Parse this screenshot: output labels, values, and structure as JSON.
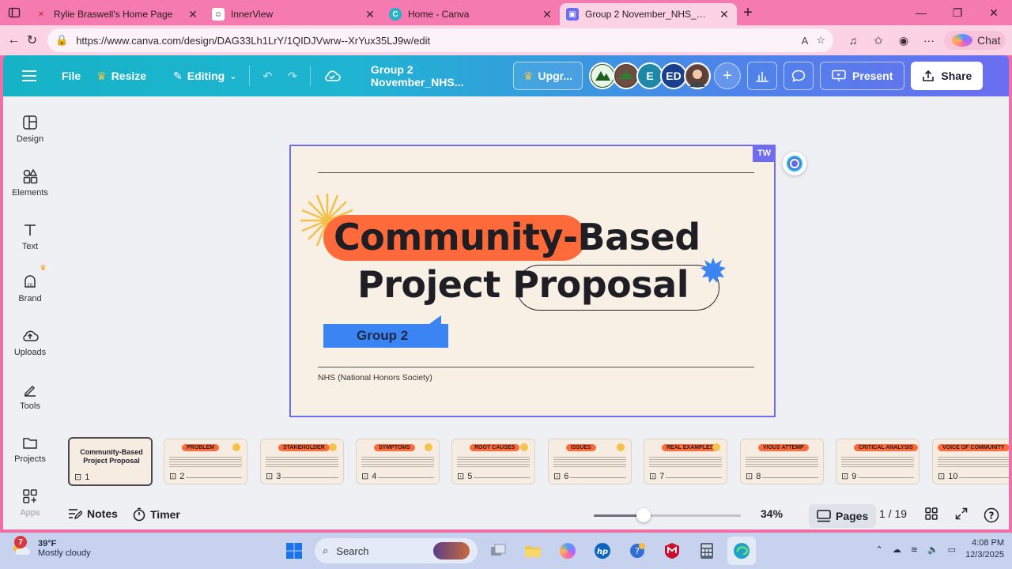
{
  "browser": {
    "tabs": [
      {
        "title": "Rylie Braswell's Home Page",
        "active": false
      },
      {
        "title": "InnerView",
        "active": false
      },
      {
        "title": "Home - Canva",
        "active": false
      },
      {
        "title": "Group 2 November_NHS_Commu",
        "active": true
      }
    ],
    "url": "https://www.canva.com/design/DAG33Lh1LrY/1QIDJVwrw--XrYux35LJ9w/edit",
    "chat_label": "Chat"
  },
  "canva_header": {
    "file_label": "File",
    "resize_label": "Resize",
    "editing_label": "Editing",
    "doc_title": "Group 2 November_NHS...",
    "upgrade_label": "Upgr...",
    "avatars": [
      "",
      "",
      "E",
      "ED",
      ""
    ],
    "present_label": "Present",
    "share_label": "Share"
  },
  "sidebar": {
    "items": [
      {
        "label": "Design",
        "icon": "design-icon"
      },
      {
        "label": "Elements",
        "icon": "elements-icon"
      },
      {
        "label": "Text",
        "icon": "text-icon"
      },
      {
        "label": "Brand",
        "icon": "brand-icon"
      },
      {
        "label": "Uploads",
        "icon": "uploads-icon"
      },
      {
        "label": "Tools",
        "icon": "tools-icon"
      },
      {
        "label": "Projects",
        "icon": "projects-icon"
      },
      {
        "label": "Apps",
        "icon": "apps-icon"
      }
    ]
  },
  "slide": {
    "badge": "TW",
    "title_line1_a": "Community",
    "title_line1_b": "-Based",
    "title_line2_a": "Project",
    "title_line2_b": "Proposal",
    "group_label": "Group 2",
    "footer": "NHS (National Honors Society)"
  },
  "thumbnails": [
    {
      "num": "1",
      "title": "Community-Based Project Proposal"
    },
    {
      "num": "2",
      "title": "PROBLEM"
    },
    {
      "num": "3",
      "title": "STAKEHOLDER"
    },
    {
      "num": "4",
      "title": "SYMPTOMS"
    },
    {
      "num": "5",
      "title": "ROOT CAUSES"
    },
    {
      "num": "6",
      "title": "ISSUES"
    },
    {
      "num": "7",
      "title": "REAL EXAMPLES"
    },
    {
      "num": "8",
      "title": "VIOUS ATTEMP"
    },
    {
      "num": "9",
      "title": "CRITICAL ANALYSIS"
    },
    {
      "num": "10",
      "title": "VOICE OF COMMUNITY"
    }
  ],
  "bottom_bar": {
    "notes_label": "Notes",
    "timer_label": "Timer",
    "zoom_value": 0.34,
    "zoom_label": "34%",
    "pages_label": "Pages",
    "page_counter": "1 / 19"
  },
  "taskbar": {
    "weather_badge": "7",
    "temperature": "39°F",
    "weather_desc": "Mostly cloudy",
    "search_placeholder": "Search",
    "time": "4:08 PM",
    "date": "12/3/2025"
  },
  "colors": {
    "accent_orange": "#ff6a3a",
    "accent_blue": "#3a84f3",
    "selection_purple": "#6f6cf2",
    "slide_bg": "#f8efe5"
  }
}
